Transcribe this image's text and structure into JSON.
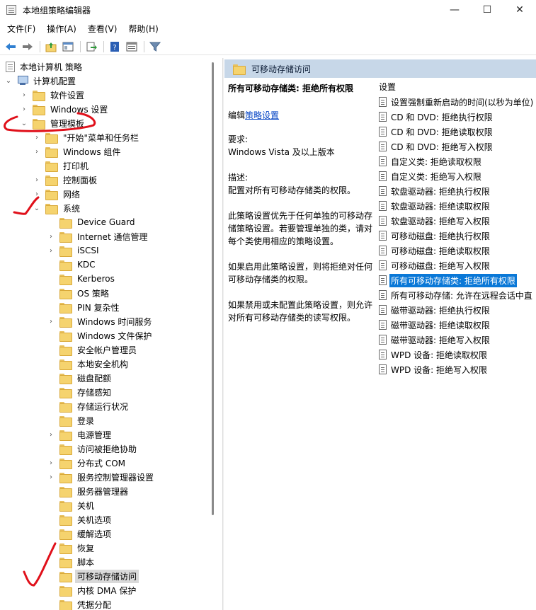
{
  "window": {
    "title": "本地组策略编辑器",
    "minimize": "—",
    "maximize": "☐",
    "close": "✕"
  },
  "menu": [
    "文件(F)",
    "操作(A)",
    "查看(V)",
    "帮助(H)"
  ],
  "tree": {
    "root": "本地计算机 策略",
    "items": [
      {
        "label": "计算机配置",
        "chevron": "⌄",
        "kind": "pc"
      },
      {
        "label": "软件设置",
        "chevron": "›",
        "kind": "folder"
      },
      {
        "label": "Windows 设置",
        "chevron": "›",
        "kind": "folder"
      },
      {
        "label": "管理模板",
        "chevron": "⌄",
        "kind": "folder"
      },
      {
        "label": "\"开始\"菜单和任务栏",
        "chevron": "›",
        "kind": "folder"
      },
      {
        "label": "Windows 组件",
        "chevron": "›",
        "kind": "folder"
      },
      {
        "label": "打印机",
        "chevron": "",
        "kind": "folder"
      },
      {
        "label": "控制面板",
        "chevron": "›",
        "kind": "folder"
      },
      {
        "label": "网络",
        "chevron": "›",
        "kind": "folder"
      },
      {
        "label": "系统",
        "chevron": "⌄",
        "kind": "folder"
      },
      {
        "label": "Device Guard",
        "chevron": "",
        "kind": "folder"
      },
      {
        "label": "Internet 通信管理",
        "chevron": "›",
        "kind": "folder"
      },
      {
        "label": "iSCSI",
        "chevron": "›",
        "kind": "folder"
      },
      {
        "label": "KDC",
        "chevron": "",
        "kind": "folder"
      },
      {
        "label": "Kerberos",
        "chevron": "",
        "kind": "folder"
      },
      {
        "label": "OS 策略",
        "chevron": "",
        "kind": "folder"
      },
      {
        "label": "PIN 复杂性",
        "chevron": "",
        "kind": "folder"
      },
      {
        "label": "Windows 时间服务",
        "chevron": "›",
        "kind": "folder"
      },
      {
        "label": "Windows 文件保护",
        "chevron": "",
        "kind": "folder"
      },
      {
        "label": "安全帐户管理员",
        "chevron": "",
        "kind": "folder"
      },
      {
        "label": "本地安全机构",
        "chevron": "",
        "kind": "folder"
      },
      {
        "label": "磁盘配额",
        "chevron": "",
        "kind": "folder"
      },
      {
        "label": "存储感知",
        "chevron": "",
        "kind": "folder"
      },
      {
        "label": "存储运行状况",
        "chevron": "",
        "kind": "folder"
      },
      {
        "label": "登录",
        "chevron": "",
        "kind": "folder"
      },
      {
        "label": "电源管理",
        "chevron": "›",
        "kind": "folder"
      },
      {
        "label": "访问被拒绝协助",
        "chevron": "",
        "kind": "folder"
      },
      {
        "label": "分布式 COM",
        "chevron": "›",
        "kind": "folder"
      },
      {
        "label": "服务控制管理器设置",
        "chevron": "›",
        "kind": "folder"
      },
      {
        "label": "服务器管理器",
        "chevron": "",
        "kind": "folder"
      },
      {
        "label": "关机",
        "chevron": "",
        "kind": "folder"
      },
      {
        "label": "关机选项",
        "chevron": "",
        "kind": "folder"
      },
      {
        "label": "缓解选项",
        "chevron": "",
        "kind": "folder"
      },
      {
        "label": "恢复",
        "chevron": "",
        "kind": "folder"
      },
      {
        "label": "脚本",
        "chevron": "",
        "kind": "folder"
      },
      {
        "label": "可移动存储访问",
        "chevron": "",
        "kind": "folder",
        "selected": true
      },
      {
        "label": "内核 DMA 保护",
        "chevron": "",
        "kind": "folder"
      },
      {
        "label": "凭据分配",
        "chevron": "",
        "kind": "folder"
      }
    ]
  },
  "right": {
    "header": "可移动存储访问",
    "description": {
      "title": "所有可移动存储类: 拒绝所有权限",
      "edit_prefix": "编辑",
      "edit_link": "策略设置",
      "requirements_label": "要求:",
      "requirements": "Windows Vista 及以上版本",
      "desc_label": "描述:",
      "desc1": "配置对所有可移动存储类的权限。",
      "desc2": "此策略设置优先于任何单独的可移动存储策略设置。若要管理单独的类，请对每个类使用相应的策略设置。",
      "desc3": "如果启用此策略设置，则将拒绝对任何可移动存储类的权限。",
      "desc4": "如果禁用或未配置此策略设置，则允许对所有可移动存储类的读写权限。"
    },
    "settings_header": "设置",
    "settings": [
      {
        "label": "设置强制重新启动的时间(以秒为单位)"
      },
      {
        "label": "CD 和 DVD: 拒绝执行权限"
      },
      {
        "label": "CD 和 DVD: 拒绝读取权限"
      },
      {
        "label": "CD 和 DVD: 拒绝写入权限"
      },
      {
        "label": "自定义类: 拒绝读取权限"
      },
      {
        "label": "自定义类: 拒绝写入权限"
      },
      {
        "label": "软盘驱动器: 拒绝执行权限"
      },
      {
        "label": "软盘驱动器: 拒绝读取权限"
      },
      {
        "label": "软盘驱动器: 拒绝写入权限"
      },
      {
        "label": "可移动磁盘: 拒绝执行权限"
      },
      {
        "label": "可移动磁盘: 拒绝读取权限"
      },
      {
        "label": "可移动磁盘: 拒绝写入权限"
      },
      {
        "label": "所有可移动存储类: 拒绝所有权限",
        "selected": true
      },
      {
        "label": "所有可移动存储: 允许在远程会话中直"
      },
      {
        "label": "磁带驱动器: 拒绝执行权限"
      },
      {
        "label": "磁带驱动器: 拒绝读取权限"
      },
      {
        "label": "磁带驱动器: 拒绝写入权限"
      },
      {
        "label": "WPD 设备: 拒绝读取权限"
      },
      {
        "label": "WPD 设备: 拒绝写入权限"
      }
    ]
  },
  "colors": {
    "selection": "#0a78d7",
    "header_bg": "#c7d7e8",
    "annotation": "#e0101a"
  }
}
